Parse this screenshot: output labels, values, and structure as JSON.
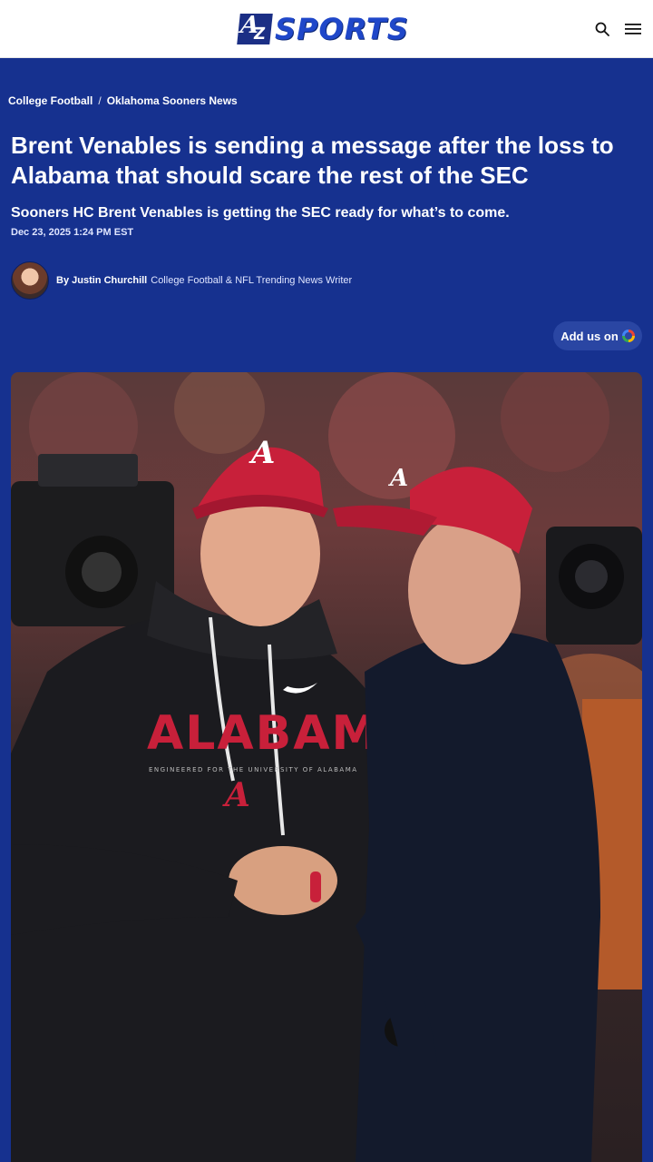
{
  "header": {
    "logo_text": "SPORTS",
    "logo_mark_a": "A",
    "logo_mark_z": "Z"
  },
  "breadcrumb": {
    "items": [
      "College Football",
      "Oklahoma Sooners News"
    ],
    "separator": "/"
  },
  "article": {
    "headline": "Brent Venables is sending a message after the loss to Alabama that should scare the rest of the SEC",
    "dek": "Sooners HC Brent Venables is getting the SEC ready for what’s to come.",
    "date": "Dec 23, 2025 1:24 PM EST",
    "author_prefix": "By",
    "author_name": "Justin Churchill",
    "author_role": "College Football & NFL Trending News Writer",
    "add_us_label": "Add us on"
  },
  "hero": {
    "cap_letter": "A",
    "hoodie_text": "ALABAMA",
    "hoodie_subtext": "ENGINEERED FOR THE UNIVERSITY OF ALABAMA"
  },
  "colors": {
    "page_bg": "#16318f",
    "brand_blue": "#1f47c9",
    "crimson": "#c8203a"
  }
}
